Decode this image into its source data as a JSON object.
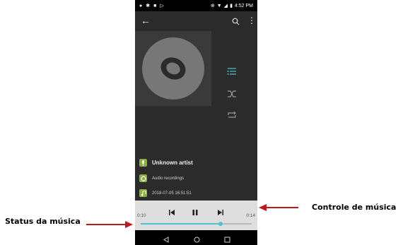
{
  "status_bar": {
    "time": "4:52 PM",
    "icons_left": [
      "notification-icon",
      "settings-icon",
      "image-icon",
      "play-store-icon"
    ],
    "icons_right": [
      "sync-icon",
      "wifi-icon",
      "signal-icon",
      "battery-icon"
    ]
  },
  "app_bar": {
    "back_icon": "arrow-left-icon",
    "search_icon": "search-icon",
    "menu_icon": "more-vert-icon"
  },
  "track_info": {
    "artist": "Unknown artist",
    "album": "Audio recordings",
    "title": "2018-07-05 16:51:51"
  },
  "player": {
    "elapsed": "0:10",
    "duration": "0:14",
    "progress_fraction": 0.72,
    "state": "playing"
  },
  "side_controls": [
    "playlist-icon",
    "shuffle-icon",
    "repeat-icon"
  ],
  "annotations": {
    "left_label": "Status da música",
    "right_label": "Controle de música"
  },
  "colors": {
    "accent": "#4fc3c9",
    "artist_icon": "#8bb03d",
    "arrow": "#c0181b"
  }
}
